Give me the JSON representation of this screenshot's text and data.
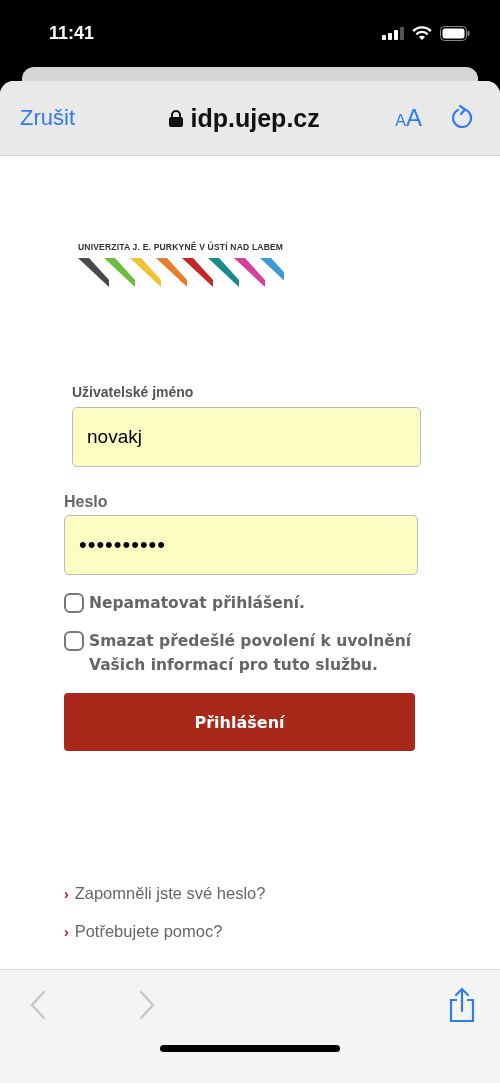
{
  "status_bar": {
    "time": "11:41"
  },
  "browser": {
    "cancel": "Zrušit",
    "address": "idp.ujep.cz",
    "text_size": "AA"
  },
  "logo": {
    "text": "UNIVERZITA J. E. PURKYNĚ V ÚSTÍ NAD LABEM"
  },
  "form": {
    "username": {
      "label": "Uživatelské jméno",
      "value": "novakj"
    },
    "password": {
      "label": "Heslo",
      "value": "••••••••••"
    },
    "options": [
      {
        "label": "Nepamatovat přihlášení.",
        "checked": false
      },
      {
        "label": "Smazat předešlé povolení k uvolnění Vašich informací pro tuto službu.",
        "checked": false
      }
    ],
    "submit": "Přihlášení"
  },
  "links": [
    {
      "marker": "›",
      "label": "Zapomněli jste své heslo?"
    },
    {
      "marker": "›",
      "label": "Potřebujete pomoc?"
    }
  ]
}
